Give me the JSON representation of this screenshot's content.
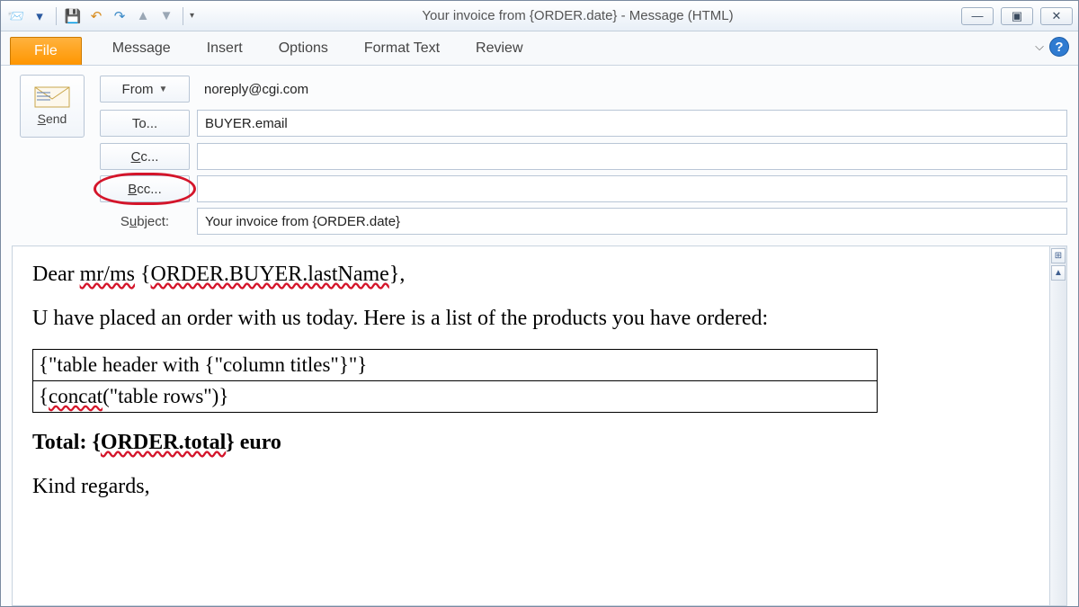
{
  "titlebar": {
    "title": "Your invoice from {ORDER.date}  -  Message (HTML)"
  },
  "ribbon": {
    "file": "File",
    "tabs": [
      "Message",
      "Insert",
      "Options",
      "Format Text",
      "Review"
    ]
  },
  "compose": {
    "send": "Send",
    "from_label": "From",
    "from_value": "noreply@cgi.com",
    "to_label": "To...",
    "to_value": "BUYER.email",
    "cc_label": "Cc...",
    "cc_value": "",
    "bcc_label": "Bcc...",
    "bcc_value": "",
    "subject_label": "Subject:",
    "subject_value": "Your invoice from {ORDER.date}"
  },
  "body": {
    "greeting_prefix": "Dear ",
    "greeting_squig1": "mr/ms",
    "greeting_mid": " {",
    "greeting_squig2": "ORDER.BUYER.lastName",
    "greeting_suffix": "},",
    "line2": "U have placed an order with us today. Here is a list of the products you have ordered:",
    "table_row1": "{\"table header with {\"column titles\"}\"}",
    "table_row2_a": "{",
    "table_row2_sq": "concat",
    "table_row2_b": "(\"table rows\")}",
    "total_prefix": "Total: {",
    "total_sq": "ORDER.total",
    "total_suffix": "} euro",
    "signoff": "Kind regards,"
  }
}
